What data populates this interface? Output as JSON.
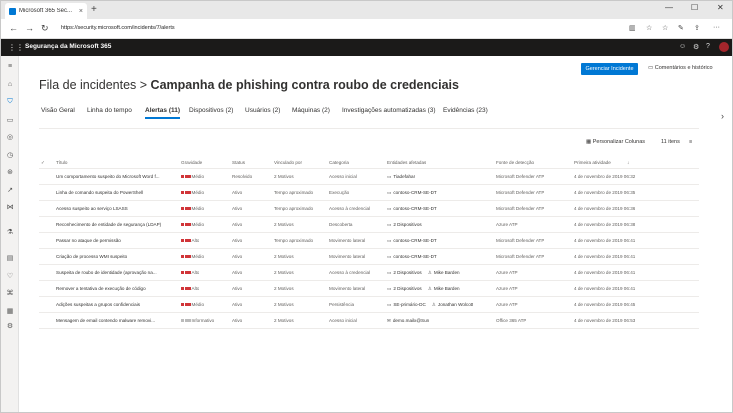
{
  "browser": {
    "tab_title": "Microsoft 365 Sec...",
    "url": "https://security.microsoft.com/incidents/7/alerts"
  },
  "app": {
    "name": "Segurança da Microsoft 365"
  },
  "page": {
    "title_prefix": "Fila de incidentes >",
    "title_main": "Campanha de phishing contra roubo de credenciais",
    "manage_button": "Gerenciar Incidente",
    "comments_link": "Comentários e histórico"
  },
  "tabs": [
    "Visão Geral",
    "Linha do tempo",
    "Alertas (11)",
    "Dispositivos (2)",
    "Usuários (2)",
    "Máquinas (2)",
    "Investigações automatizadas (3)",
    "Evidências (23)"
  ],
  "toolbar": {
    "customize_columns": "Personalizar Colunas",
    "item_count": "11 itens"
  },
  "columns": [
    "Título",
    "Gravidade",
    "Status",
    "Vinculado por",
    "Categoria",
    "Entidades afetadas",
    "Fonte de detecção",
    "Primeira atividade"
  ],
  "rows": [
    {
      "title": "Um comportamento suspeito do Microsoft Word f...",
      "severity": "Médio",
      "sev_level": 3,
      "status": "Resolvido",
      "linked": "2 Motivos",
      "category": "Acesso inicial",
      "entity": "Tiadefahar",
      "entity_icon": "device",
      "entity2": "",
      "source": "Microsoft Defender ATP",
      "first": "4 de novembro de 2019 06:32"
    },
    {
      "title": "Linha de comando suspeita do PowerShell",
      "severity": "Médio",
      "sev_level": 3,
      "status": "Ativo",
      "linked": "Tempo aproximado",
      "category": "Execução",
      "entity": "contoso-CRM-SE-DT",
      "entity_icon": "device",
      "entity2": "",
      "source": "Microsoft Defender ATP",
      "first": "4 de novembro de 2019 06:35"
    },
    {
      "title": "Acesso suspeito ao serviço LSASS",
      "severity": "Médio",
      "sev_level": 3,
      "status": "Ativo",
      "linked": "Tempo aproximado",
      "category": "Acesso à credencial",
      "entity": "contoso-CRM-SE-DT",
      "entity_icon": "device",
      "entity2": "",
      "source": "Microsoft Defender ATP",
      "first": "4 de novembro de 2019 06:36"
    },
    {
      "title": "Reconhecimento de entidade de segurança (LDAP)",
      "severity": "Médio",
      "sev_level": 3,
      "status": "Ativo",
      "linked": "2 Motivos",
      "category": "Descoberta",
      "entity": "2 Dispositivos",
      "entity_icon": "device",
      "entity2": "",
      "source": "Azure ATP",
      "first": "4 de novembro de 2019 06:38"
    },
    {
      "title": "Passar no ataque de permissão",
      "severity": "Alto",
      "sev_level": 3,
      "status": "Ativo",
      "linked": "Tempo aproximado",
      "category": "Movimento lateral",
      "entity": "contoso-CRM-SE-DT",
      "entity_icon": "device",
      "entity2": "",
      "source": "Microsoft Defender ATP",
      "first": "4 de novembro de 2019 06:41"
    },
    {
      "title": "Criação de processo WMI suspeito",
      "severity": "Médio",
      "sev_level": 3,
      "status": "Ativo",
      "linked": "2 Motivos",
      "category": "Movimento lateral",
      "entity": "contoso-CRM-SE-DT",
      "entity_icon": "device",
      "entity2": "",
      "source": "Microsoft Defender ATP",
      "first": "4 de novembro de 2019 06:41"
    },
    {
      "title": "Suspeita de roubo de identidade (aprovação na...",
      "severity": "Alto",
      "sev_level": 3,
      "status": "Ativo",
      "linked": "2 Motivos",
      "category": "Acesso à credencial",
      "entity": "2 Dispositivos",
      "entity_icon": "device",
      "entity2": "Mike Barden",
      "source": "Azure ATP",
      "first": "4 de novembro de 2019 06:41"
    },
    {
      "title": "Remover a tentativa de execução de código",
      "severity": "Alto",
      "sev_level": 3,
      "status": "Ativo",
      "linked": "2 Motivos",
      "category": "Movimento lateral",
      "entity": "2 Dispositivos",
      "entity_icon": "device",
      "entity2": "Mike Barden",
      "source": "Azure ATP",
      "first": "4 de novembro de 2019 06:41"
    },
    {
      "title": "Adições suspeitas a grupos confidenciais",
      "severity": "Médio",
      "sev_level": 3,
      "status": "Ativo",
      "linked": "2 Motivos",
      "category": "Persistência",
      "entity": "SE-primário-DC",
      "entity_icon": "device",
      "entity2": "Jonathan Wolcott",
      "source": "Azure ATP",
      "first": "4 de novembro de 2019 06:45"
    },
    {
      "title": "Mensagem de email contendo malware removi...",
      "severity": "Informativo",
      "sev_level": 0,
      "status": "Ativo",
      "linked": "2 Motivos",
      "category": "Acesso inicial",
      "entity": "demo.mailx@Sun",
      "entity_icon": "mail",
      "entity2": "",
      "source": "Office 365 ATP",
      "first": "4 de novembro de 2019 06:53"
    }
  ]
}
